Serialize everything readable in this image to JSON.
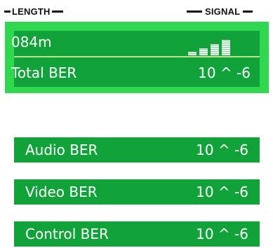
{
  "headers": {
    "length": "LENGTH",
    "signal": "SIGNAL"
  },
  "main": {
    "length_value": "084m",
    "total_ber_label": "Total BER",
    "total_ber_value": "10 ^ -6",
    "signal_level": 4,
    "signal_max": 5
  },
  "ber_rows": [
    {
      "label": "Audio BER",
      "value": "10 ^ -6"
    },
    {
      "label": "Video BER",
      "value": "10 ^ -6"
    },
    {
      "label": "Control BER",
      "value": "10 ^ -6"
    }
  ],
  "colors": {
    "panel_bright_green": "#2fd84e",
    "row_dark_green": "#11a33a",
    "text": "#ffffff",
    "header_text": "#111111"
  }
}
